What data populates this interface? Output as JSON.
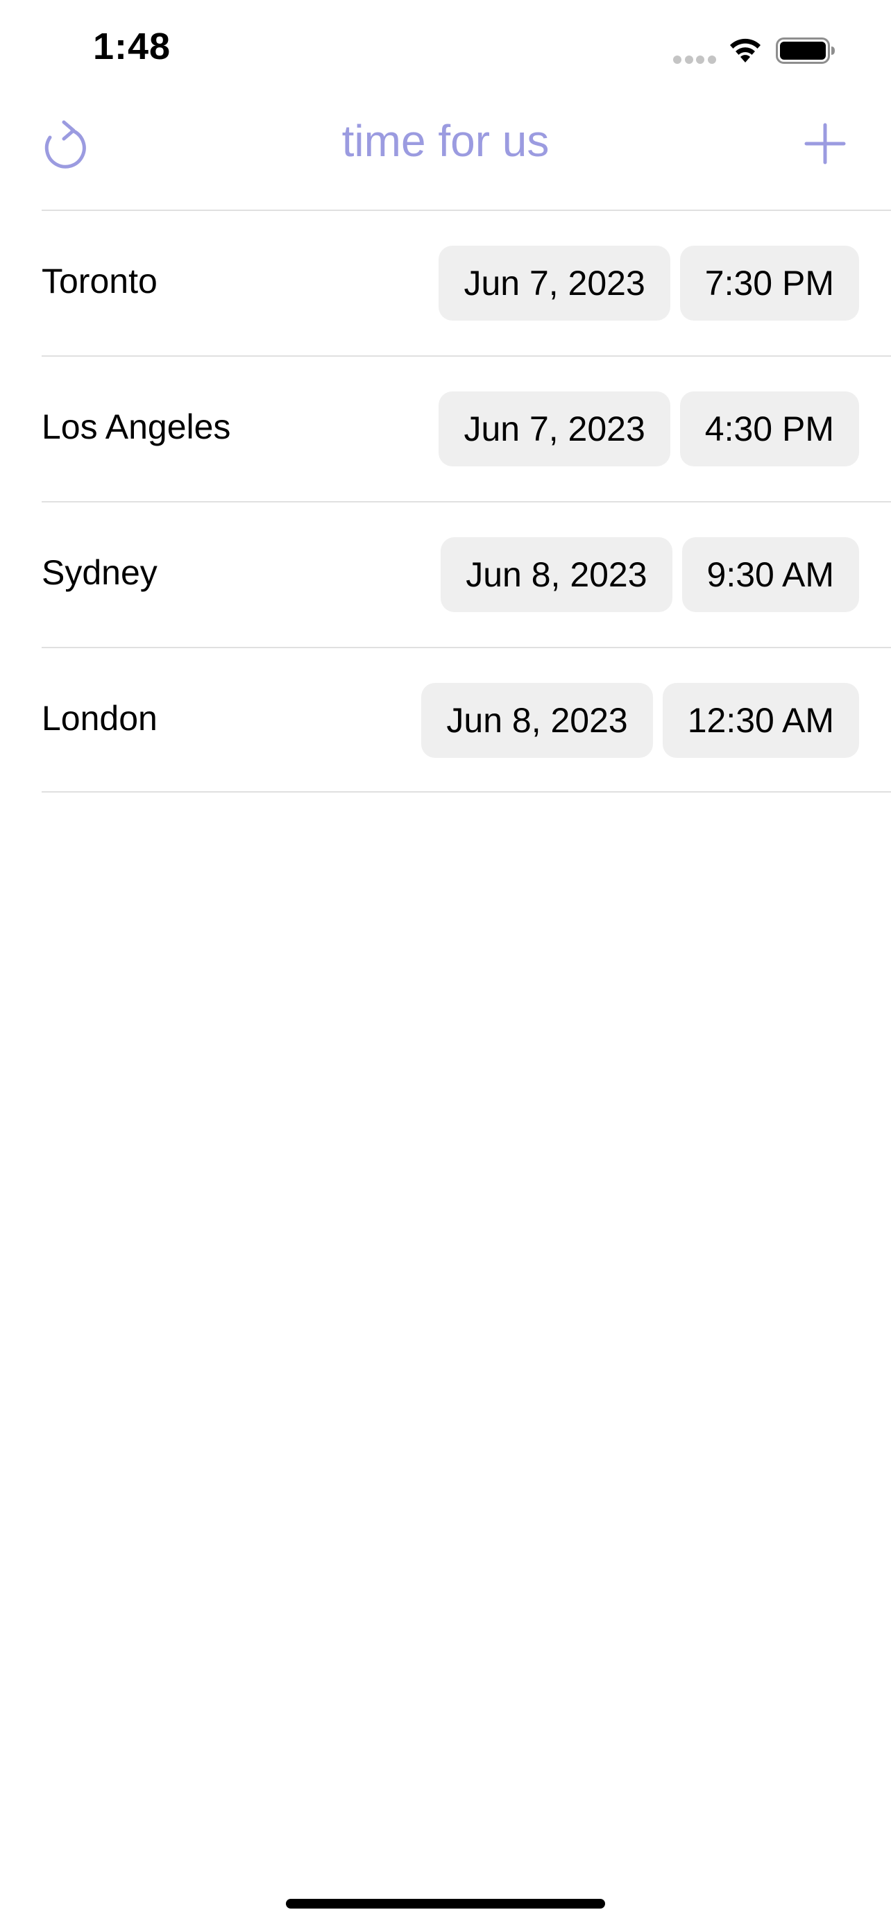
{
  "status_bar": {
    "time": "1:48"
  },
  "nav": {
    "title": "time for us",
    "refresh_icon": "refresh-icon",
    "add_icon": "plus-icon",
    "accent_color": "#9b9be0"
  },
  "rows": [
    {
      "city": "Toronto",
      "date": "Jun 7, 2023",
      "time": "7:30 PM"
    },
    {
      "city": "Los Angeles",
      "date": "Jun 7, 2023",
      "time": "4:30 PM"
    },
    {
      "city": "Sydney",
      "date": "Jun 8, 2023",
      "time": "9:30 AM"
    },
    {
      "city": "London",
      "date": "Jun 8, 2023",
      "time": "12:30 AM"
    }
  ]
}
